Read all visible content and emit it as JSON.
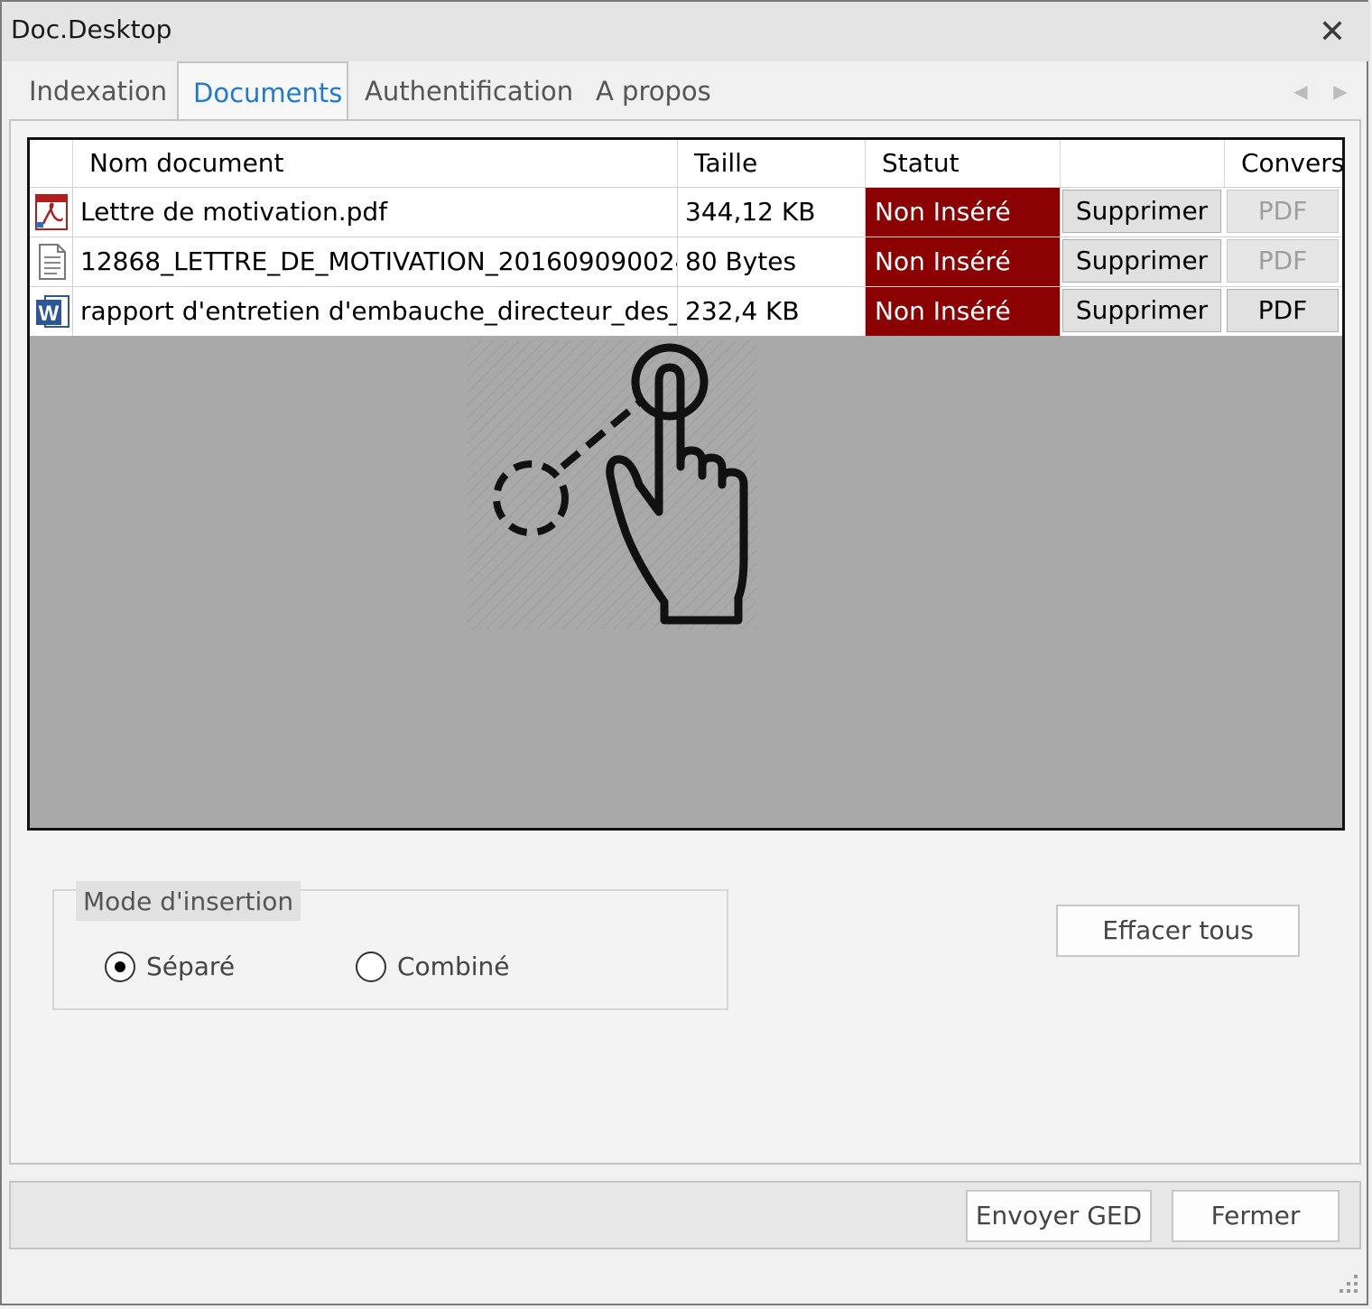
{
  "window": {
    "title": "Doc.Desktop"
  },
  "tabs": [
    {
      "label": "Indexation"
    },
    {
      "label": "Documents"
    },
    {
      "label": "Authentification"
    },
    {
      "label": "A propos"
    }
  ],
  "active_tab": "Documents",
  "grid": {
    "columns": [
      "Nom document",
      "Taille",
      "Statut",
      "",
      "Convers"
    ],
    "rows": [
      {
        "icon": "pdf-icon",
        "name": "Lettre de motivation.pdf",
        "size": "344,12 KB",
        "status": "Non Inséré",
        "delete_label": "Supprimer",
        "convert_label": "PDF",
        "convert_enabled": false
      },
      {
        "icon": "text-file-icon",
        "name": "12868_LETTRE_DE_MOTIVATION_2016090900244...",
        "size": "80 Bytes",
        "status": "Non Inséré",
        "delete_label": "Supprimer",
        "convert_label": "PDF",
        "convert_enabled": false
      },
      {
        "icon": "word-icon",
        "name": "rapport d'entretien d'embauche_directeur_des_...",
        "size": "232,4 KB",
        "status": "Non Inséré",
        "delete_label": "Supprimer",
        "convert_label": "PDF",
        "convert_enabled": true
      }
    ],
    "drop_zone_icon": "touch-drag-icon"
  },
  "mode": {
    "legend": "Mode d'insertion",
    "options": [
      {
        "label": "Séparé",
        "selected": true
      },
      {
        "label": "Combiné",
        "selected": false
      }
    ]
  },
  "actions": {
    "clear_all": "Effacer tous",
    "send": "Envoyer GED",
    "close": "Fermer"
  },
  "colors": {
    "status_bg": "#8b0000",
    "active_tab_text": "#1f7bd1",
    "grid_bg": "#a9a9a9"
  }
}
